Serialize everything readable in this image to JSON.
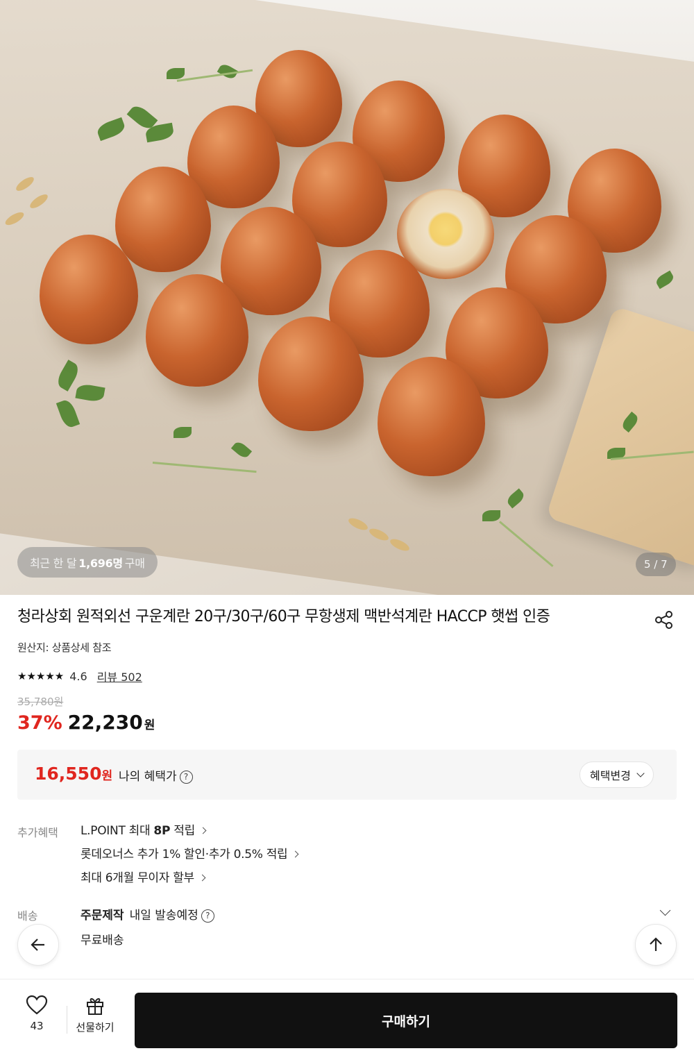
{
  "hero": {
    "buyers_prefix": "최근 한 달",
    "buyers_count": "1,696명",
    "buyers_suffix": "구매",
    "page_counter": "5 / 7"
  },
  "product": {
    "title": "청라상회 원적외선 구운계란 20구/30구/60구 무항생제 맥반석계란 HACCP 햇썹 인증",
    "origin": "원산지: 상품상세 참조",
    "rating": "4.6",
    "rating_value": 4.6,
    "review_label": "리뷰 502",
    "original_price": "35,780원",
    "discount_rate": "37%",
    "sale_price": "22,230",
    "currency": "원"
  },
  "benefit": {
    "price": "16,550",
    "currency": "원",
    "label": "나의 혜택가",
    "help": "?",
    "change_button": "혜택변경"
  },
  "extra": {
    "label": "추가혜택",
    "items": [
      {
        "prefix": "L.POINT 최대 ",
        "bold": "8P",
        "suffix": " 적립"
      },
      {
        "prefix": "롯데오너스 추가 1% 할인·추가 0.5% 적립",
        "bold": "",
        "suffix": ""
      },
      {
        "prefix": "최대 6개월 무이자 할부",
        "bold": "",
        "suffix": ""
      }
    ]
  },
  "shipping": {
    "label": "배송",
    "type": "주문제작",
    "schedule": "내일 발송예정",
    "help": "?",
    "fee": "무료배송"
  },
  "bottom": {
    "wish_count": "43",
    "gift_label": "선물하기",
    "buy_label": "구매하기"
  },
  "colors": {
    "accent_red": "#e0261f",
    "buy_button": "#111111"
  },
  "icons": [
    "share-icon",
    "help-icon",
    "chevron-down-icon",
    "chevron-right-icon",
    "arrow-left-icon",
    "arrow-up-icon",
    "heart-icon",
    "gift-icon"
  ]
}
